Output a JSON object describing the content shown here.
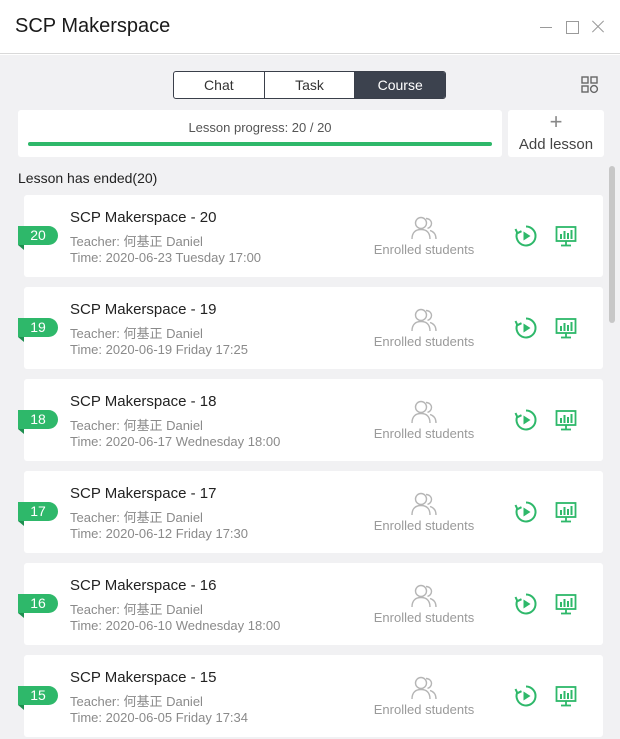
{
  "window": {
    "title": "SCP Makerspace"
  },
  "tabs": [
    {
      "label": "Chat",
      "active": false
    },
    {
      "label": "Task",
      "active": false
    },
    {
      "label": "Course",
      "active": true
    }
  ],
  "progress": {
    "label": "Lesson progress: 20 / 20",
    "fraction": 1.0
  },
  "add_lesson": {
    "icon": "plus-icon",
    "label": "Add lesson"
  },
  "section": {
    "title": "Lesson has ended(20)"
  },
  "lessons": [
    {
      "number": "20",
      "title": "SCP Makerspace - 20",
      "teacher": "Teacher: 何基正 Daniel",
      "time": "Time: 2020-06-23 Tuesday 17:00",
      "enrolled_label": "Enrolled students"
    },
    {
      "number": "19",
      "title": "SCP Makerspace - 19",
      "teacher": "Teacher: 何基正 Daniel",
      "time": "Time: 2020-06-19 Friday 17:25",
      "enrolled_label": "Enrolled students"
    },
    {
      "number": "18",
      "title": "SCP Makerspace - 18",
      "teacher": "Teacher: 何基正 Daniel",
      "time": "Time: 2020-06-17 Wednesday 18:00",
      "enrolled_label": "Enrolled students"
    },
    {
      "number": "17",
      "title": "SCP Makerspace - 17",
      "teacher": "Teacher: 何基正 Daniel",
      "time": "Time: 2020-06-12 Friday 17:30",
      "enrolled_label": "Enrolled students"
    },
    {
      "number": "16",
      "title": "SCP Makerspace - 16",
      "teacher": "Teacher: 何基正 Daniel",
      "time": "Time: 2020-06-10 Wednesday 18:00",
      "enrolled_label": "Enrolled students"
    },
    {
      "number": "15",
      "title": "SCP Makerspace - 15",
      "teacher": "Teacher: 何基正 Daniel",
      "time": "Time: 2020-06-05 Friday 17:34",
      "enrolled_label": "Enrolled students"
    }
  ],
  "colors": {
    "accent": "#2eb86a",
    "active_tab": "#3c424e",
    "background": "#f1f1f3"
  }
}
